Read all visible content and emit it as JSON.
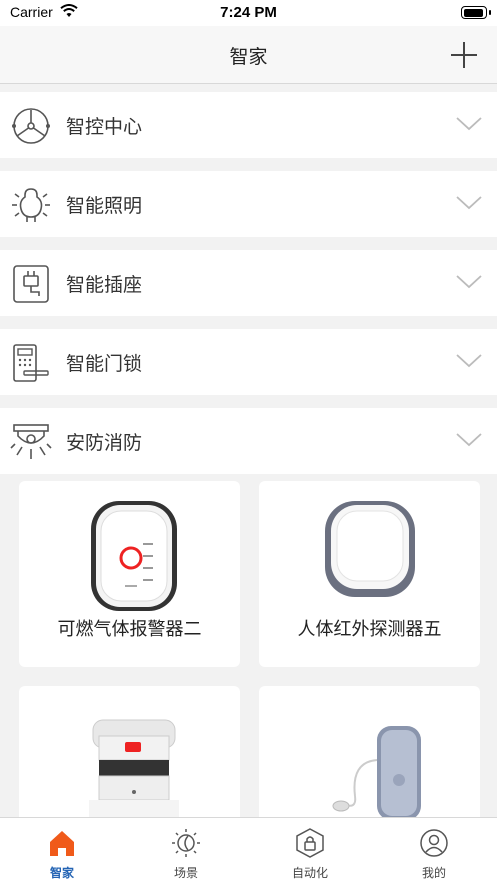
{
  "status_bar": {
    "carrier": "Carrier",
    "time": "7:24 PM"
  },
  "nav": {
    "title": "智家",
    "add_icon": "plus-icon"
  },
  "categories": [
    {
      "label": "智控中心",
      "icon": "control-hub-icon"
    },
    {
      "label": "智能照明",
      "icon": "light-bulb-icon"
    },
    {
      "label": "智能插座",
      "icon": "plug-socket-icon"
    },
    {
      "label": "智能门锁",
      "icon": "door-lock-icon"
    },
    {
      "label": "安防消防",
      "icon": "security-camera-icon"
    }
  ],
  "devices": [
    {
      "name": "可燃气体报警器二",
      "icon": "gas-detector-image"
    },
    {
      "name": "人体红外探测器五",
      "icon": "motion-sensor-image"
    },
    {
      "name": "",
      "icon": "smoke-detector-image"
    },
    {
      "name": "",
      "icon": "water-leak-sensor-image"
    }
  ],
  "tabs": [
    {
      "label": "智家",
      "icon": "home-icon",
      "active": true
    },
    {
      "label": "场景",
      "icon": "scene-sun-icon",
      "active": false
    },
    {
      "label": "自动化",
      "icon": "automation-lock-icon",
      "active": false
    },
    {
      "label": "我的",
      "icon": "profile-icon",
      "active": false
    }
  ],
  "colors": {
    "accent": "#f05a1a",
    "tab_active": "#2464b4",
    "background": "#f2f2f2"
  }
}
